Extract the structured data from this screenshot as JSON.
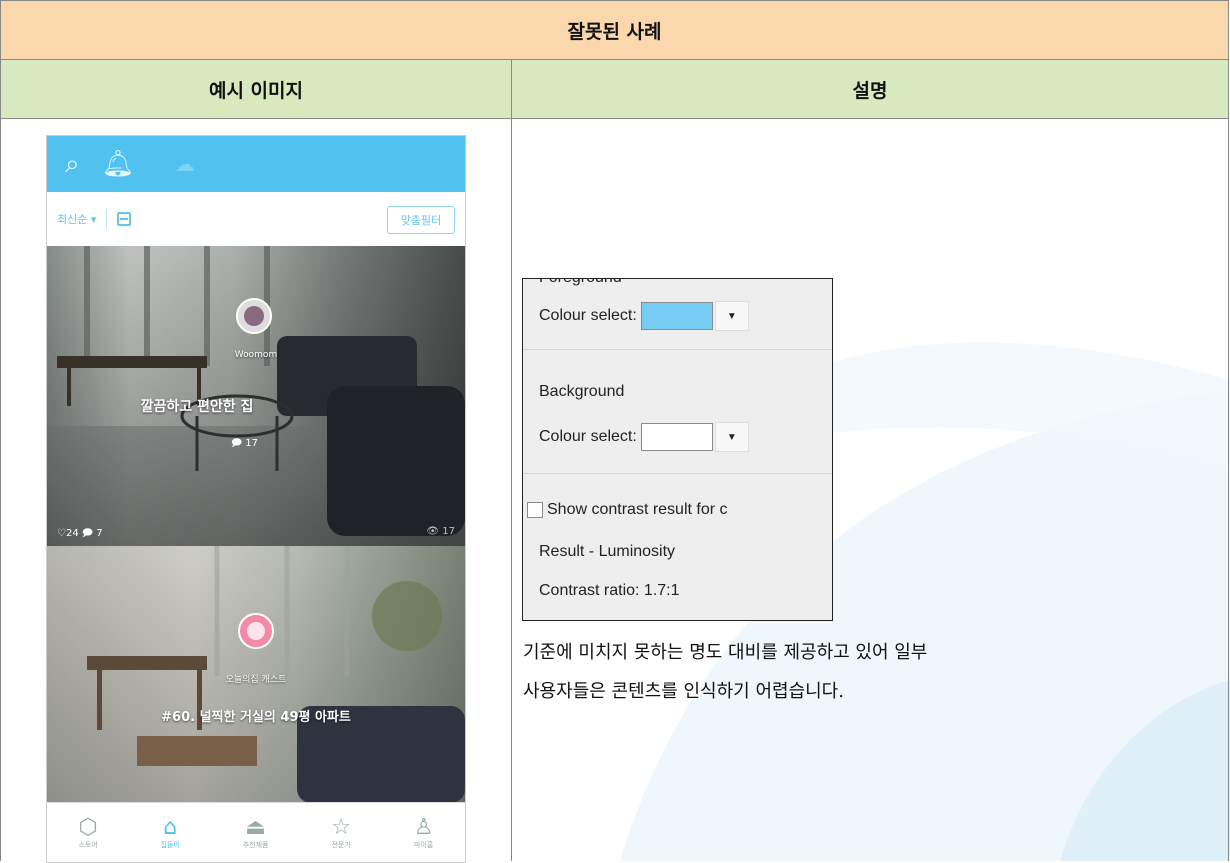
{
  "table": {
    "title": "잘못된 사례",
    "col_image": "예시 이미지",
    "col_desc": "설명"
  },
  "phone": {
    "sort_label": "최신순 ▾",
    "filter_button": "맞춤필터",
    "card1": {
      "author": "Woomom",
      "title": "깔끔하고 편안한 집",
      "comments": "17",
      "likes": "♡24",
      "replies": "7",
      "views": "17"
    },
    "card2": {
      "author": "오늘의집 캐스트",
      "title": "#60. 널찍한 거실의 49평 아파트"
    },
    "nav": [
      "스토어",
      "집들이",
      "추천제품",
      "전문가",
      "마이홈"
    ]
  },
  "dialog": {
    "foreground_label": "Foreground",
    "fg_colour_label": "Colour select:",
    "fg_colour": "#78cdf4",
    "background_label": "Background",
    "bg_colour_label": "Colour select:",
    "bg_colour": "#ffffff",
    "checkbox_label": "Show contrast result for c",
    "result_label": "Result - Luminosity",
    "contrast_ratio": "Contrast ratio: 1.7:1"
  },
  "description": {
    "line1": "기준에 미치지 못하는 명도 대비를 제공하고 있어 일부",
    "line2": "사용자들은 콘텐츠를 인식하기 어렵습니다."
  }
}
